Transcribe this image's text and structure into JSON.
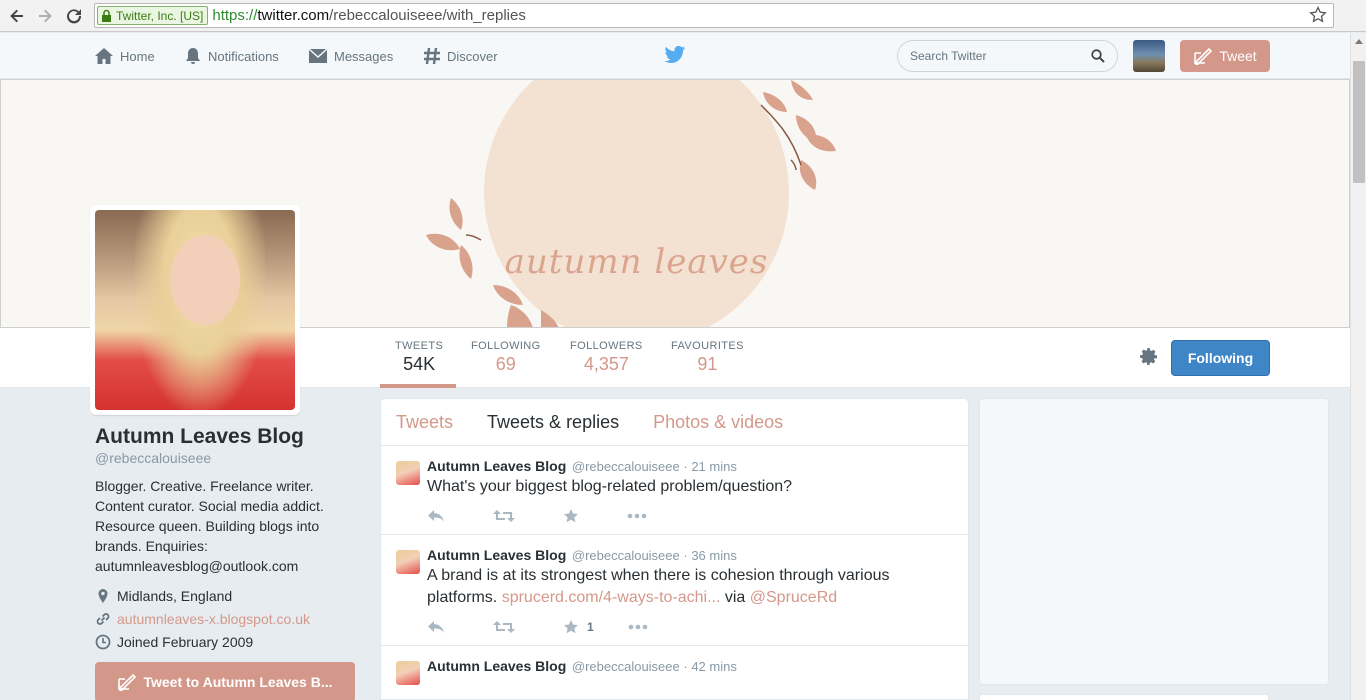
{
  "browser": {
    "ev_label": "Twitter, Inc. [US]",
    "url_scheme": "https://",
    "url_host": "twitter.com",
    "url_path": "/rebeccalouiseee/with_replies"
  },
  "nav": {
    "home": "Home",
    "notifications": "Notifications",
    "messages": "Messages",
    "discover": "Discover",
    "search_placeholder": "Search Twitter",
    "tweet_button": "Tweet"
  },
  "banner": {
    "text": "autumn leaves"
  },
  "stats": [
    {
      "label": "TWEETS",
      "value": "54K"
    },
    {
      "label": "FOLLOWING",
      "value": "69"
    },
    {
      "label": "FOLLOWERS",
      "value": "4,357"
    },
    {
      "label": "FAVOURITES",
      "value": "91"
    }
  ],
  "follow_button": "Following",
  "profile": {
    "name": "Autumn Leaves Blog",
    "handle": "@rebeccalouiseee",
    "bio": "Blogger. Creative. Freelance writer. Content curator. Social media addict. Resource queen. Building blogs into brands. Enquiries: autumnleavesblog@outlook.com",
    "location": "Midlands, England",
    "website": "autumnleaves-x.blogspot.co.uk",
    "joined": "Joined February 2009",
    "tweet_to": "Tweet to Autumn Leaves B..."
  },
  "tabs": [
    "Tweets",
    "Tweets & replies",
    "Photos & videos"
  ],
  "tweets": [
    {
      "name": "Autumn Leaves Blog",
      "handle": "@rebeccalouiseee",
      "time": "· 21 mins",
      "text": "What's your biggest blog-related problem/question?",
      "fav_count": ""
    },
    {
      "name": "Autumn Leaves Blog",
      "handle": "@rebeccalouiseee",
      "time": "· 36 mins",
      "text_before": "A brand is at its strongest when there is cohesion through various platforms. ",
      "link": "sprucerd.com/4-ways-to-achi...",
      "text_mid": " via ",
      "mention": "@SpruceRd",
      "fav_count": "1"
    },
    {
      "name": "Autumn Leaves Blog",
      "handle": "@rebeccalouiseee",
      "time": "· 42 mins"
    }
  ],
  "colors": {
    "accent": "#d4988a",
    "follow_blue": "#3f86c7",
    "banner_circle": "#f3e2d2"
  }
}
